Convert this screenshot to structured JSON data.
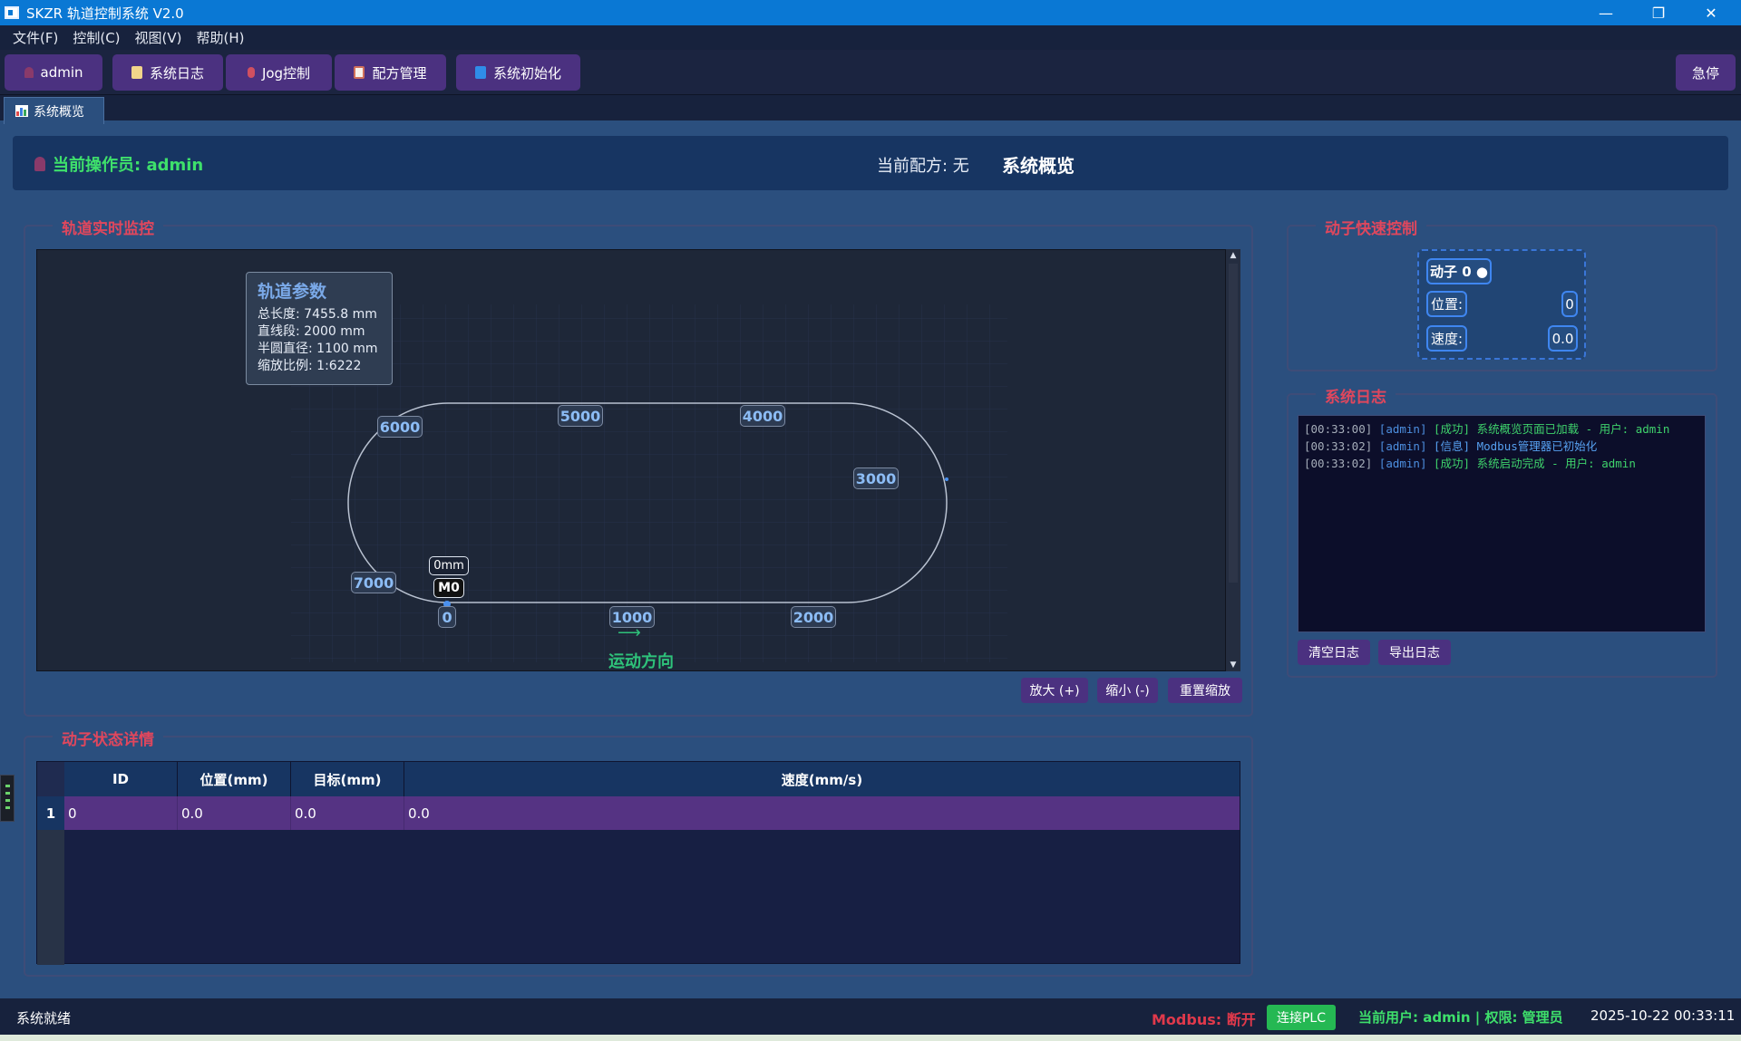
{
  "window": {
    "title": "SKZR 轨道控制系统 V2.0"
  },
  "menu": [
    "文件(F)",
    "控制(C)",
    "视图(V)",
    "帮助(H)"
  ],
  "toolbar": {
    "user": "admin",
    "log": "系统日志",
    "jog": "Jog控制",
    "recipe": "配方管理",
    "init": "系统初始化",
    "estop": "急停"
  },
  "tab": {
    "label": "系统概览"
  },
  "header": {
    "operator": "当前操作员: admin",
    "recipe": "当前配方: 无",
    "title": "系统概览"
  },
  "track_monitor": {
    "title": "轨道实时监控",
    "params": {
      "title": "轨道参数",
      "lines": [
        "总长度: 7455.8 mm",
        "直线段: 2000 mm",
        "半圆直径: 1100 mm",
        "缩放比例: 1:6222"
      ]
    },
    "positions": [
      "0",
      "1000",
      "2000",
      "3000",
      "4000",
      "5000",
      "6000",
      "7000"
    ],
    "mover": {
      "id": "M0",
      "position": "0mm"
    },
    "direction_label": "运动方向",
    "direction_arrow": "⟶",
    "zoom_in": "放大 (+)",
    "zoom_out": "缩小 (-)",
    "zoom_reset": "重置缩放"
  },
  "mover_status": {
    "title": "动子状态详情",
    "columns": [
      "ID",
      "位置(mm)",
      "目标(mm)",
      "速度(mm/s)"
    ],
    "rows": [
      {
        "index": "1",
        "cells": [
          "0",
          "0.0",
          "0.0",
          "0.0"
        ]
      }
    ]
  },
  "quick_control": {
    "title": "动子快速控制",
    "mover_label": "动子 0 ●",
    "position_label": "位置:",
    "position_value": "0",
    "speed_label": "速度:",
    "speed_value": "0.0"
  },
  "system_log": {
    "title": "系统日志",
    "entries": [
      {
        "time": "[00:33:00]",
        "user": "[admin]",
        "msg": "[成功] 系统概览页面已加载 - 用户: admin",
        "kind": "success"
      },
      {
        "time": "[00:33:02]",
        "user": "[admin]",
        "msg": "[信息] Modbus管理器已初始化",
        "kind": "info"
      },
      {
        "time": "[00:33:02]",
        "user": "[admin]",
        "msg": "[成功] 系统启动完成 - 用户: admin",
        "kind": "success"
      }
    ],
    "clear": "清空日志",
    "export": "导出日志"
  },
  "status_bar": {
    "ready": "系统就绪",
    "modbus": "Modbus: 断开",
    "connect": "连接PLC",
    "user_info": "当前用户: admin | 权限: 管理员",
    "datetime": "2025-10-22 00:33:11"
  },
  "colors": {
    "accent_purple": "#4b3180",
    "title_red": "#e0475d",
    "status_green": "#3ee06b",
    "label_blue": "#8cbcf5"
  }
}
